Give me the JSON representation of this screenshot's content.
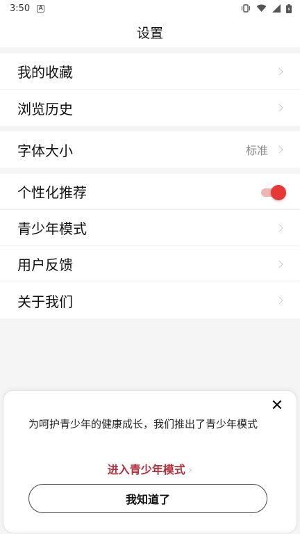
{
  "status_bar": {
    "time": "3:50",
    "app_badge": "A"
  },
  "header": {
    "title": "设置"
  },
  "groups": [
    {
      "items": [
        {
          "label": "我的收藏"
        },
        {
          "label": "浏览历史"
        }
      ]
    },
    {
      "items": [
        {
          "label": "字体大小",
          "value": "标准"
        }
      ]
    },
    {
      "items": [
        {
          "label": "个性化推荐",
          "toggle_on": true
        },
        {
          "label": "青少年模式"
        },
        {
          "label": "用户反馈"
        },
        {
          "label": "关于我们"
        }
      ]
    }
  ],
  "modal": {
    "message": "为呵护青少年的健康成长，我们推出了青少年模式",
    "link_label": "进入青少年模式",
    "confirm_label": "我知道了"
  },
  "colors": {
    "accent": "#e53935",
    "link": "#b2303b",
    "toggle_track": "#f2b3b3"
  }
}
